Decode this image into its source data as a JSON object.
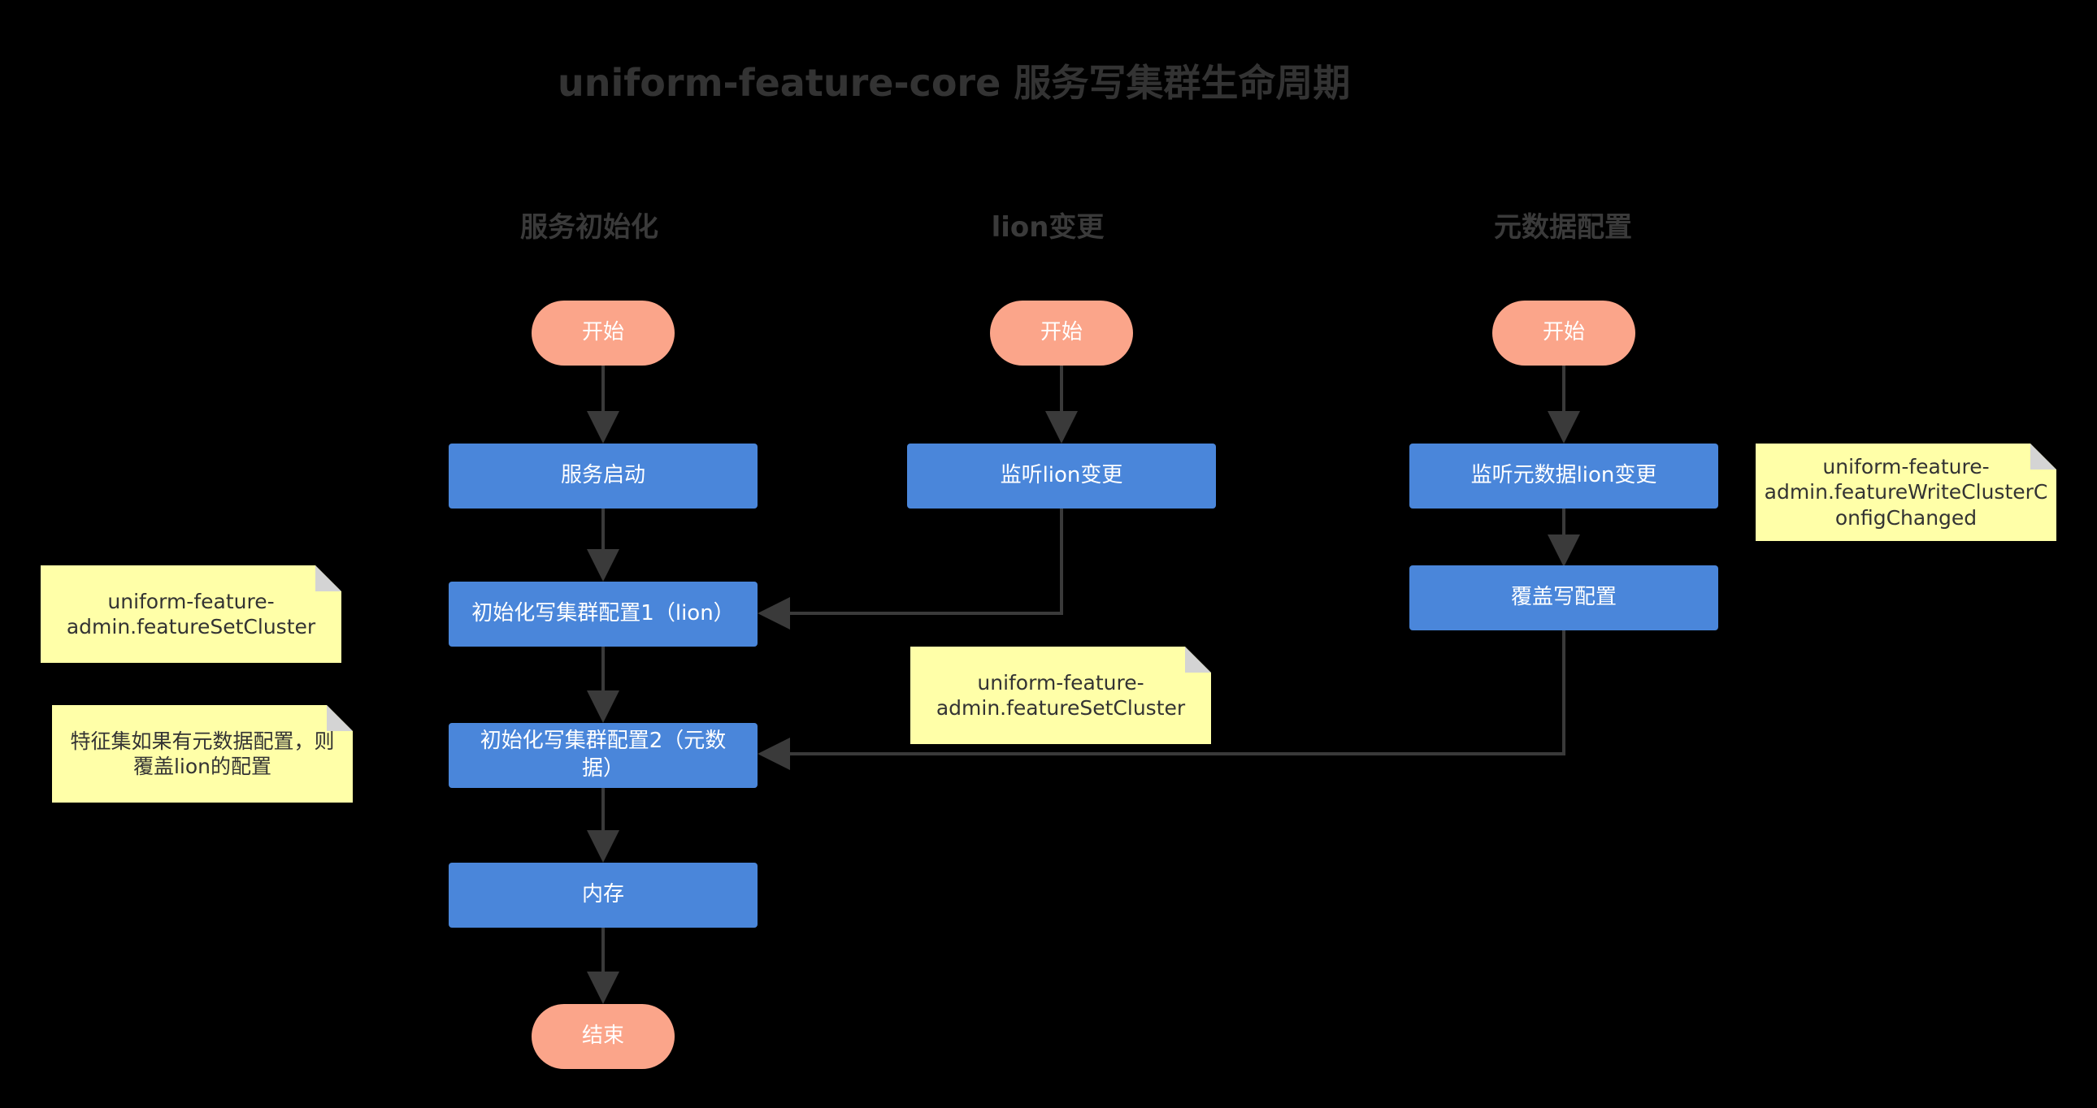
{
  "title": "uniform-feature-core 服务写集群生命周期",
  "columns": {
    "init": "服务初始化",
    "lion": "lion变更",
    "meta": "元数据配置"
  },
  "nodes": {
    "start1": "开始",
    "start2": "开始",
    "start3": "开始",
    "service_start": "服务启动",
    "init_config1": "初始化写集群配置1（lion）",
    "init_config2": "初始化写集群配置2（元数据）",
    "memory": "内存",
    "end": "结束",
    "listen_lion": "监听lion变更",
    "listen_meta_lion": "监听元数据lion变更",
    "overwrite_config": "覆盖写配置"
  },
  "notes": {
    "note_left1": "uniform-feature-\nadmin.featureSetCluster",
    "note_left2": "特征集如果有元数据配置，则\n覆盖lion的配置",
    "note_mid": "uniform-feature-\nadmin.featureSetCluster",
    "note_right": "uniform-feature-\nadmin.featureWriteClusterC\nonfigChanged"
  },
  "colors": {
    "background": "#000000",
    "terminal": "#fba58a",
    "process": "#4a86da",
    "note": "#ffffa8",
    "edge": "#3a3a3a"
  }
}
